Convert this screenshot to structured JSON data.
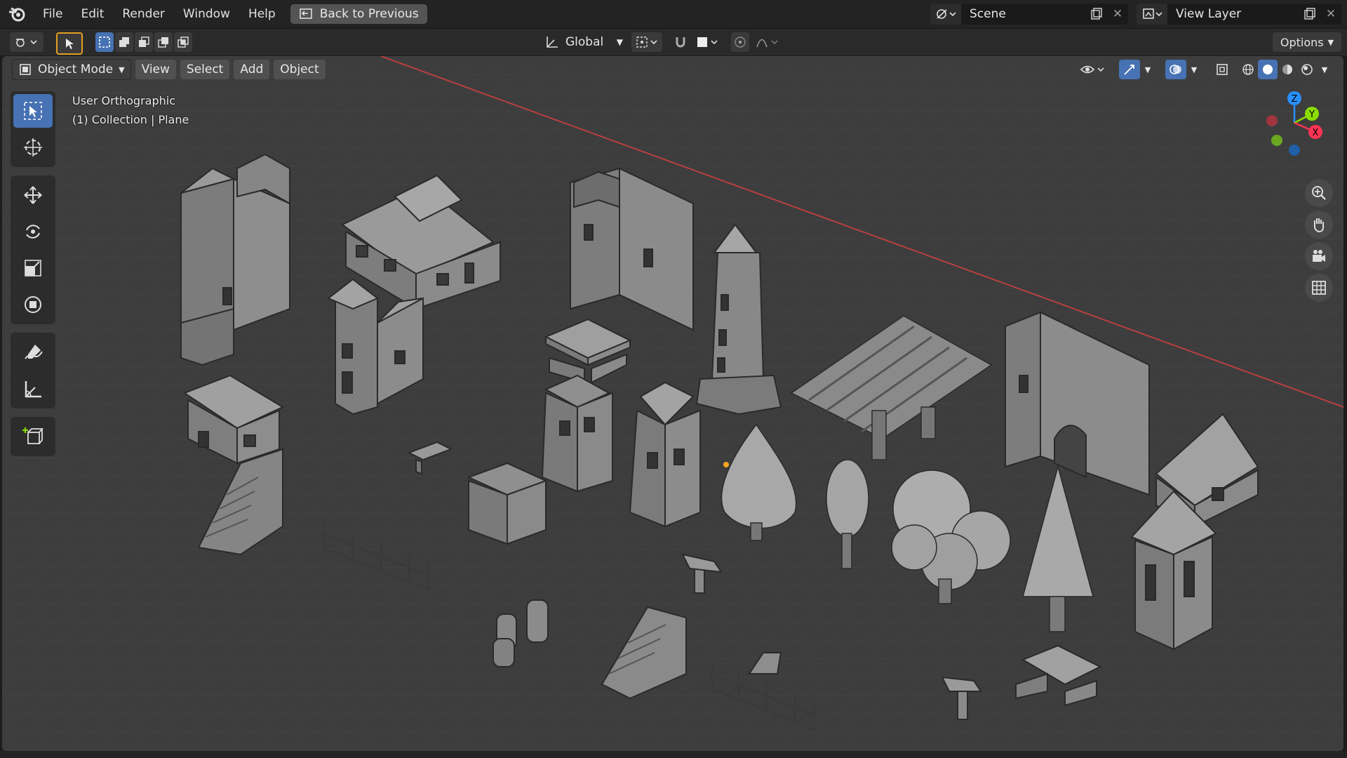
{
  "menu": {
    "items": [
      "File",
      "Edit",
      "Render",
      "Window",
      "Help"
    ],
    "back_button": "Back to Previous"
  },
  "scene": {
    "label": "Scene"
  },
  "view_layer": {
    "label": "View Layer"
  },
  "tool_settings": {
    "transform_orientation": "Global",
    "options_label": "Options"
  },
  "viewport": {
    "mode": "Object Mode",
    "header_menus": [
      "View",
      "Select",
      "Add",
      "Object"
    ],
    "overlay_line1": "User Orthographic",
    "overlay_line2": "(1) Collection | Plane"
  },
  "gizmo": {
    "z": "Z",
    "y": "Y",
    "x": "X"
  },
  "colors": {
    "accent": "#4772b3",
    "axis_x": "#ff3352",
    "axis_y": "#8bdc00",
    "axis_z": "#2890ff",
    "viewport_bg": "#3d3d3d"
  },
  "tools": [
    "select-box-icon",
    "cursor-icon",
    "move-icon",
    "rotate-icon",
    "scale-icon",
    "transform-icon",
    "annotate-icon",
    "measure-icon",
    "add-cube-icon"
  ]
}
